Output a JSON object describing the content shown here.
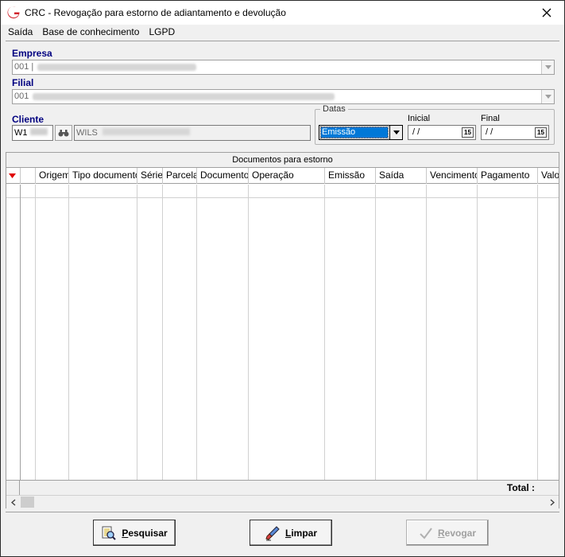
{
  "window": {
    "title": "CRC - Revogação para estorno de adiantamento e devolução",
    "close_glyph": "✕"
  },
  "menu": [
    {
      "label": "Saída"
    },
    {
      "label": "Base de conhecimento"
    },
    {
      "label": "LGPD"
    }
  ],
  "form": {
    "empresa_label": "Empresa",
    "empresa_value": "001 |",
    "filial_label": "Filial",
    "filial_value": "001",
    "cliente_label": "Cliente",
    "cliente_code": "W1",
    "cliente_name": "WILS",
    "datas_label": "Datas",
    "datas_type_value": "Emissão",
    "inicial_label": "Inicial",
    "inicial_value": "/  /",
    "final_label": "Final",
    "final_value": "/  /",
    "calendar_glyph": "15"
  },
  "grid": {
    "title": "Documentos para estorno",
    "columns": [
      "Origem",
      "Tipo documento",
      "Série",
      "Parcela",
      "Documento",
      "Operação",
      "Emissão",
      "Saída",
      "Vencimento",
      "Pagamento",
      "Valor"
    ],
    "total_label": "Total :"
  },
  "buttons": {
    "pesquisar_accel": "P",
    "pesquisar_rest": "esquisar",
    "limpar_accel": "L",
    "limpar_rest": "impar",
    "revogar_accel": "R",
    "revogar_rest": "evogar"
  },
  "colors": {
    "label_blue": "#000080",
    "selection_blue": "#0078d7",
    "sort_marker_red": "#e00000",
    "logo_red": "#d0202a"
  }
}
